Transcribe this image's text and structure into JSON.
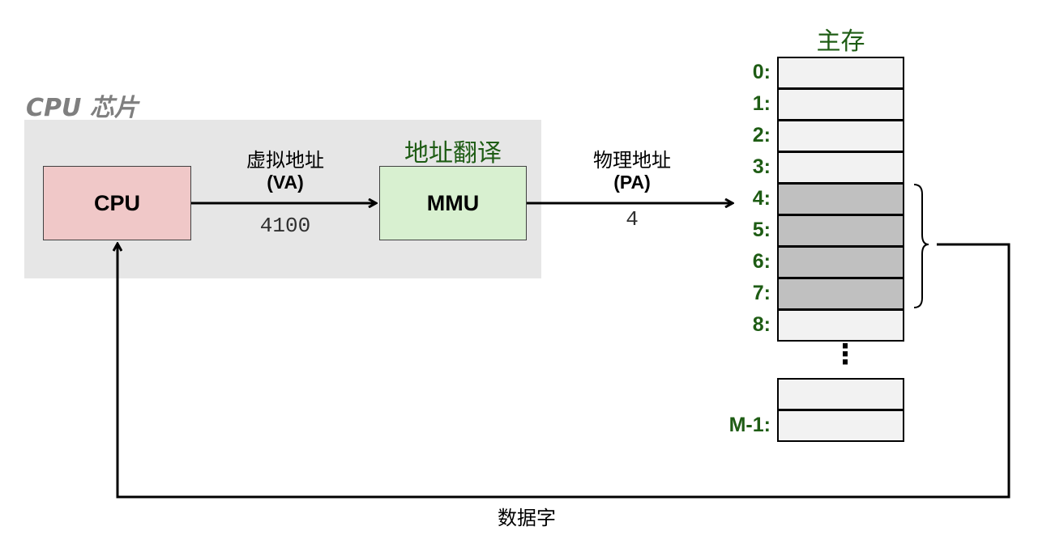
{
  "chip": {
    "label": "CPU 芯片"
  },
  "cpu": {
    "label": "CPU"
  },
  "mmu": {
    "title": "地址翻译",
    "label": "MMU"
  },
  "virtual_address": {
    "title": "虚拟地址",
    "abbr": "(VA)",
    "value": "4100"
  },
  "physical_address": {
    "title": "物理地址",
    "abbr": "(PA)",
    "value": "4"
  },
  "memory": {
    "title": "主存",
    "cells": [
      {
        "index": "0:",
        "shaded": false
      },
      {
        "index": "1:",
        "shaded": false
      },
      {
        "index": "2:",
        "shaded": false
      },
      {
        "index": "3:",
        "shaded": false
      },
      {
        "index": "4:",
        "shaded": true
      },
      {
        "index": "5:",
        "shaded": true
      },
      {
        "index": "6:",
        "shaded": true
      },
      {
        "index": "7:",
        "shaded": true
      },
      {
        "index": "8:",
        "shaded": false
      }
    ],
    "ellipsis": "⋮",
    "tail_cells": [
      {
        "index": ""
      },
      {
        "index": "M-1:"
      }
    ]
  },
  "data_word": {
    "label": "数据字"
  },
  "colors": {
    "green": "#1e5c14",
    "cpu_fill": "#f0c8c8",
    "mmu_fill": "#d8f0d0",
    "chip_bg": "#e6e6e6",
    "shaded": "#c0c0c0"
  }
}
